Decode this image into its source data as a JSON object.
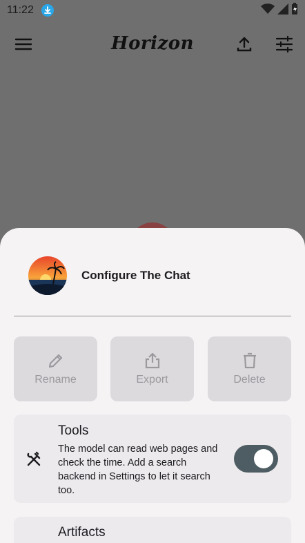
{
  "status_bar": {
    "time": "11:22",
    "icons": [
      "download-icon",
      "wifi-icon",
      "signal-icon",
      "battery-icon"
    ]
  },
  "app_bar": {
    "title": "Horizon",
    "icons": [
      "menu-icon",
      "upload-icon",
      "tune-icon"
    ]
  },
  "sheet": {
    "title": "Configure The Chat",
    "actions": [
      {
        "label": "Rename",
        "icon": "pencil-icon"
      },
      {
        "label": "Export",
        "icon": "share-icon"
      },
      {
        "label": "Delete",
        "icon": "trash-icon"
      }
    ],
    "tools": {
      "title": "Tools",
      "description": "The model can read web pages and check the time. Add a search backend in Settings to let it search too.",
      "icon": "tools-icon",
      "enabled": true
    },
    "artifacts": {
      "title": "Artifacts"
    }
  },
  "colors": {
    "scrim": "#6f6f6f",
    "sheet_bg": "#f5f3f4",
    "card_bg": "#eceaed",
    "action_bg": "#dcdadd",
    "toggle_on": "#4e5d63",
    "download_badge": "#29a7e8"
  }
}
